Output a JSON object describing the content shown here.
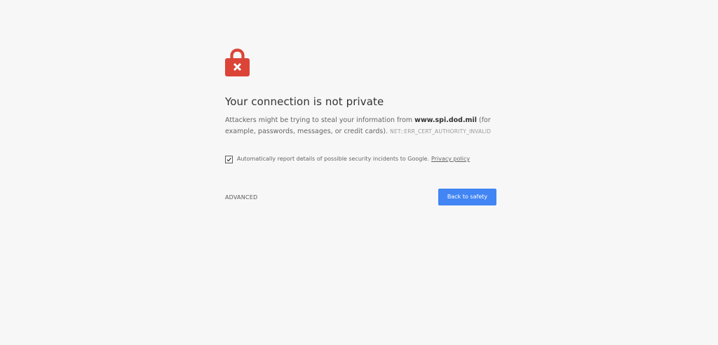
{
  "page": {
    "background_color": "#f7f7f7",
    "icon": "lock-error-icon",
    "icon_color": "#db4437",
    "title": "Your connection is not private",
    "explanation": {
      "prefix": "Attackers might be trying to steal your information from ",
      "host": "www.spi.dod.mil",
      "suffix": " (for example, passwords, messages, or credit cards).",
      "error_code": "NET::ERR_CERT_AUTHORITY_INVALID"
    },
    "report": {
      "checked": true,
      "text": "Automatically report details of possible security incidents to Google.",
      "privacy_link": "Privacy policy"
    },
    "advanced_label": "ADVANCED",
    "primary_button_label": "Back to safety",
    "primary_button_color": "#4285f4"
  }
}
